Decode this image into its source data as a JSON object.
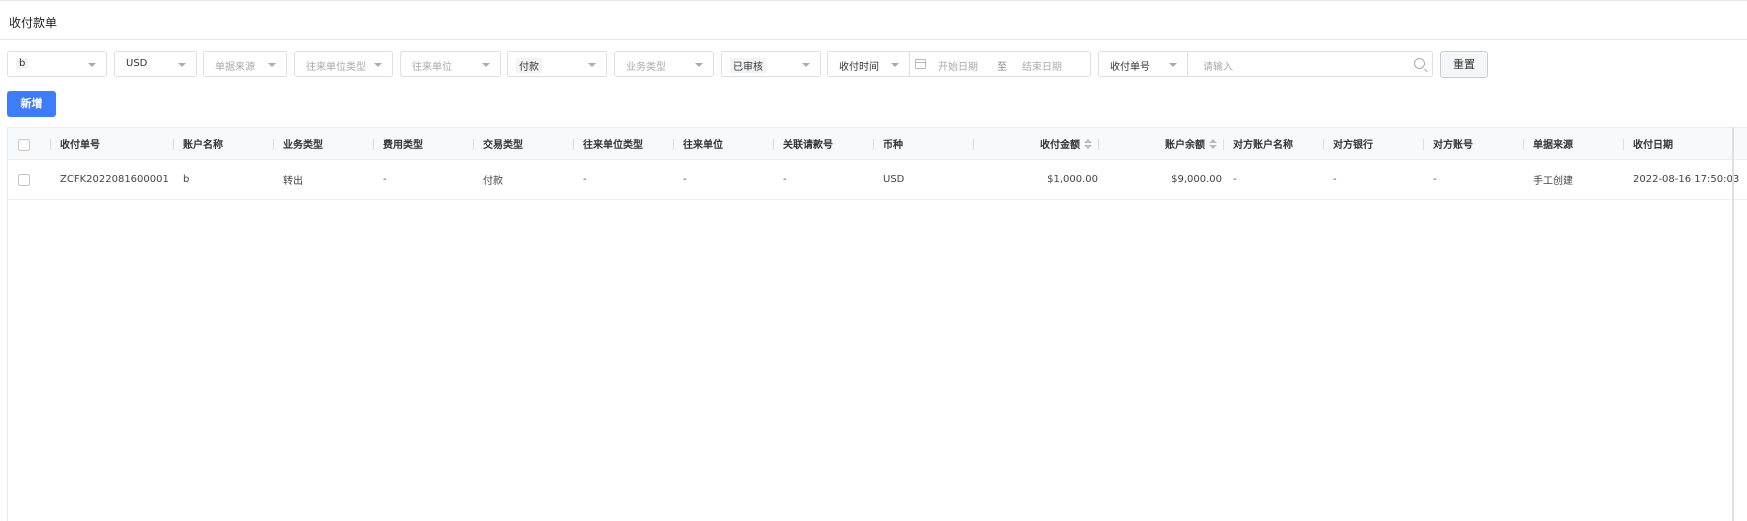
{
  "page": {
    "title": "收付款单"
  },
  "filters": {
    "account": "b",
    "currency": "USD",
    "source": "单据来源",
    "partner_type": "往来单位类型",
    "partner": "往来单位",
    "trade_type": "付款",
    "business_type": "业务类型",
    "status": "已审核",
    "time_field": "收付时间",
    "start_date": "开始日期",
    "date_sep": "至",
    "end_date": "结束日期",
    "search_field": "收付单号",
    "search_placeholder": "请输入"
  },
  "actions": {
    "reset": "重置",
    "add": "新增"
  },
  "table": {
    "columns": [
      "收付单号",
      "账户名称",
      "业务类型",
      "费用类型",
      "交易类型",
      "往来单位类型",
      "往来单位",
      "关联请款号",
      "币种",
      "收付金额",
      "账户余额",
      "对方账户名称",
      "对方银行",
      "对方账号",
      "单据来源",
      "收付日期"
    ],
    "rows": [
      [
        "ZCFK2022081600001",
        "b",
        "转出",
        "-",
        "付款",
        "-",
        "-",
        "-",
        "USD",
        "$1,000.00",
        "$9,000.00",
        "-",
        "-",
        "-",
        "手工创建",
        "2022-08-16 17:50:03"
      ]
    ]
  }
}
